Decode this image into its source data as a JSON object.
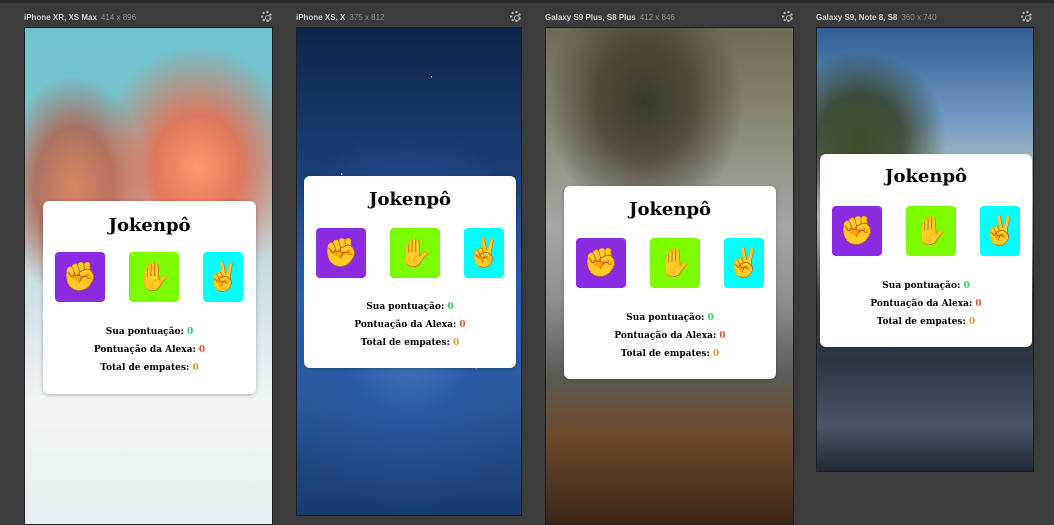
{
  "devices": [
    {
      "name": "iPhone XR, XS Max",
      "size": "414 x 896"
    },
    {
      "name": "iPhone XS, X",
      "size": "375 x 812"
    },
    {
      "name": "Galaxy S9 Plus, S8 Plus",
      "size": "412 x 846"
    },
    {
      "name": "Galaxy S9, Note 8, S8",
      "size": "360 x 740"
    }
  ],
  "game": {
    "title": "Jokenpô",
    "rock_icon": "✊",
    "paper_icon": "✋",
    "scissors_icon": "✌",
    "player_score_label": "Sua pontuação:",
    "player_score": "0",
    "alexa_score_label": "Pontuação da Alexa:",
    "alexa_score": "0",
    "ties_label": "Total de empates:",
    "ties": "0"
  },
  "colors": {
    "rock_button": "#8a2be2",
    "paper_button": "#7cfc00",
    "scissors_button": "#00ffff",
    "player_score": "#2ecc71",
    "alexa_score": "#e74c3c",
    "ties": "#d4a017"
  },
  "icons": {
    "settings": "gear-icon",
    "rock": "fist-icon",
    "paper": "hand-icon",
    "scissors": "victory-hand-icon"
  }
}
